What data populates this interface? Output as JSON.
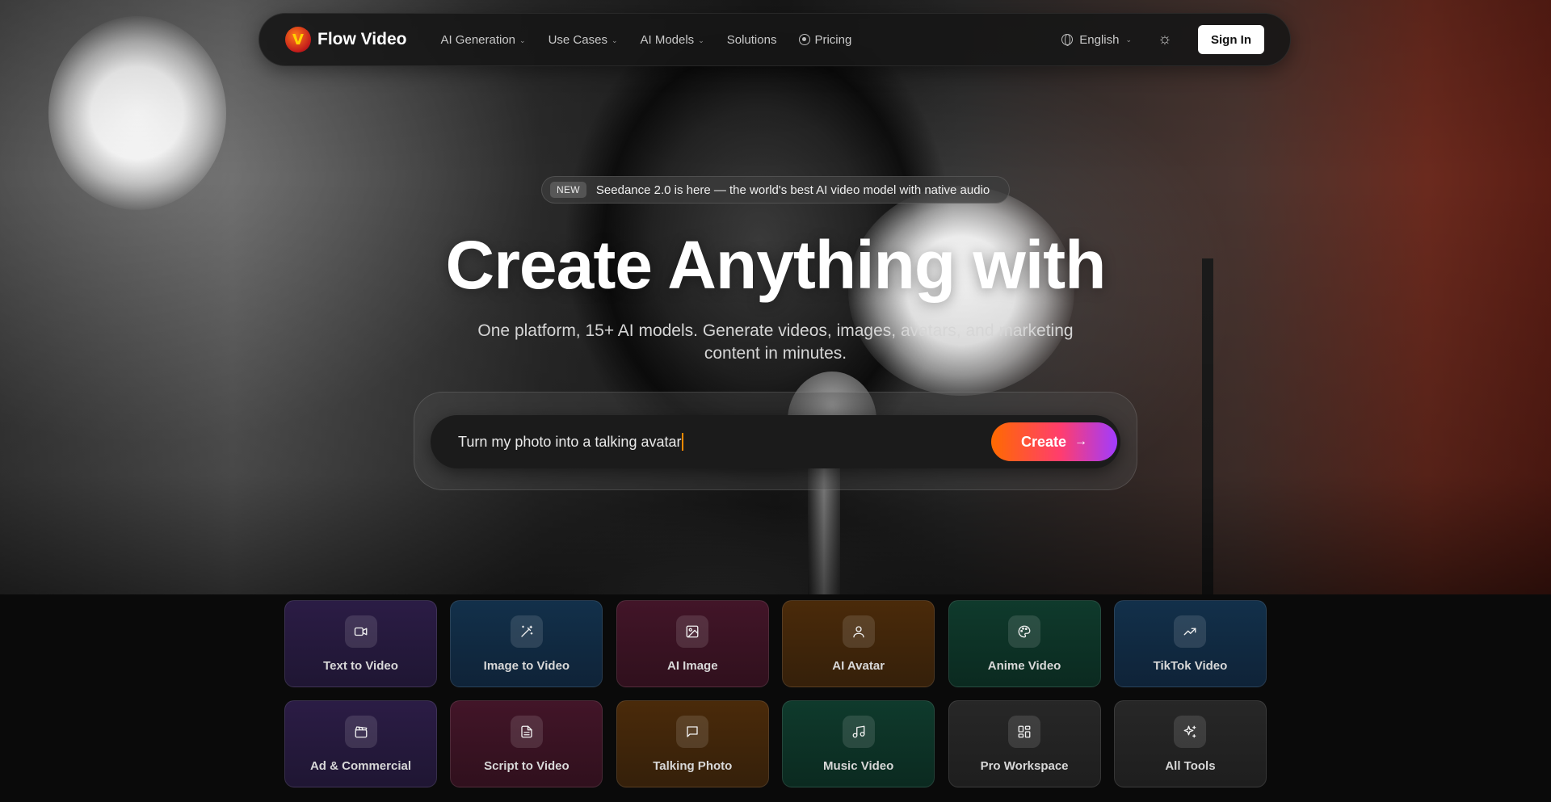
{
  "nav": {
    "brand": "Flow Video",
    "items": [
      {
        "label": "AI Generation",
        "has_dropdown": true
      },
      {
        "label": "Use Cases",
        "has_dropdown": true
      },
      {
        "label": "AI Models",
        "has_dropdown": true
      },
      {
        "label": "Solutions",
        "has_dropdown": false
      }
    ],
    "pricing": "Pricing",
    "language": "English",
    "signin": "Sign In"
  },
  "announcement": {
    "badge": "NEW",
    "text": "Seedance 2.0 is here — the world's best AI video model with native audio"
  },
  "hero": {
    "headline": "Create Anything with",
    "subhead": "One platform, 15+ AI models. Generate videos, images, avatars, and marketing content in minutes."
  },
  "prompt": {
    "value": "Turn my photo into a talking avatar",
    "create_label": "Create"
  },
  "tools": [
    {
      "label": "Text to Video",
      "icon": "video-camera-icon",
      "color": "#2b1c45"
    },
    {
      "label": "Image to Video",
      "icon": "magic-wand-icon",
      "color": "#12304a"
    },
    {
      "label": "AI Image",
      "icon": "image-icon",
      "color": "#421528"
    },
    {
      "label": "AI Avatar",
      "icon": "user-icon",
      "color": "#4a2a0a"
    },
    {
      "label": "Anime Video",
      "icon": "palette-icon",
      "color": "#0f3a2c"
    },
    {
      "label": "TikTok Video",
      "icon": "trending-up-icon",
      "color": "#12304a"
    },
    {
      "label": "Ad & Commercial",
      "icon": "clapperboard-icon",
      "color": "#2b1c45"
    },
    {
      "label": "Script to Video",
      "icon": "document-icon",
      "color": "#421528"
    },
    {
      "label": "Talking Photo",
      "icon": "chat-bubble-icon",
      "color": "#4a2a0a"
    },
    {
      "label": "Music Video",
      "icon": "music-note-icon",
      "color": "#0f3a2c"
    },
    {
      "label": "Pro Workspace",
      "icon": "grid-layout-icon",
      "color": "#272727"
    },
    {
      "label": "All Tools",
      "icon": "sparkles-icon",
      "color": "#272727"
    }
  ]
}
